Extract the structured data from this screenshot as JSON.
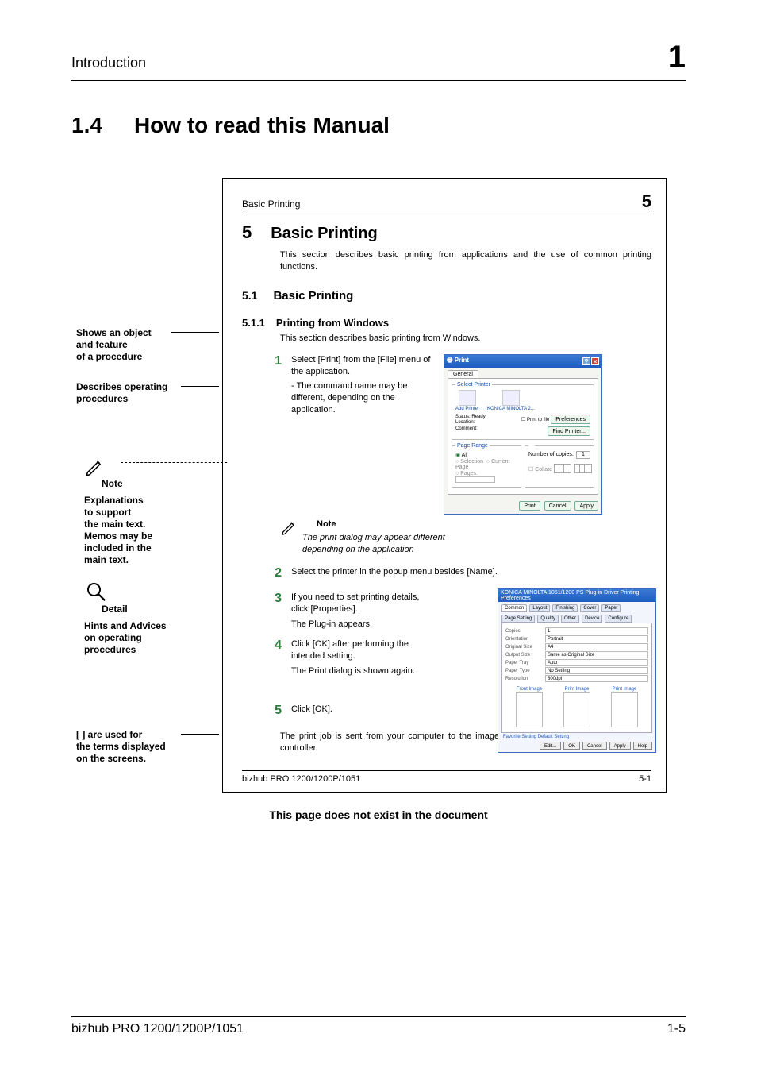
{
  "header": {
    "chapter_label": "Introduction",
    "chapter_number": "1"
  },
  "heading": {
    "number": "1.4",
    "title": "How to read this Manual"
  },
  "annotations": {
    "a1": "Shows an object\nand feature\nof a procedure",
    "a2": "Describes operating\nprocedures",
    "note_label": "Note",
    "a3": "Explanations\nto support\nthe main text.\nMemos may be\nincluded in the\nmain text.",
    "detail_label": "Detail",
    "a4": "Hints and Advices\non operating\nprocedures",
    "a5": "[ ] are used for\nthe terms displayed\non the screens."
  },
  "sample": {
    "running_left": "Basic Printing",
    "running_right": "5",
    "h5_num": "5",
    "h5_title": "Basic Printing",
    "h5_body": "This section describes basic printing from applications and the use of common printing functions.",
    "h51_num": "5.1",
    "h51_title": "Basic Printing",
    "h511_num": "5.1.1",
    "h511_title": "Printing from Windows",
    "h511_body": "This section describes basic printing from Windows.",
    "steps": [
      {
        "n": "1",
        "text": "Select [Print] from the [File] menu of the application.",
        "sub": "- The command name may be different, depending on the application."
      },
      {
        "n": "2",
        "text": "Select the printer in the popup menu besides [Name]."
      },
      {
        "n": "3",
        "text": "If you need to set printing details, click [Properties].",
        "sub": "The Plug-in appears."
      },
      {
        "n": "4",
        "text": "Click [OK] after performing the intended setting.",
        "sub": "The Print dialog is shown again."
      },
      {
        "n": "5",
        "text": "Click [OK]."
      }
    ],
    "note_label": "Note",
    "note_text": "The print dialog may appear different depending on the application",
    "final_text": "The print job is sent from your computer to the image controller and then processed by the controller.",
    "footer_left": "bizhub PRO 1200/1200P/1051",
    "footer_right": "5-1"
  },
  "print_dialog": {
    "title": "Print",
    "tab": "General",
    "select_printer_legend": "Select Printer",
    "printers": [
      "Add Printer",
      "KONICA MINOLTA 2..."
    ],
    "status_label": "Status:",
    "status_value": "Ready",
    "location_label": "Location:",
    "comment_label": "Comment:",
    "print_to_file": "Print to file",
    "preferences_btn": "Preferences",
    "find_printer_btn": "Find Printer...",
    "page_range_legend": "Page Range",
    "range_all": "All",
    "range_selection": "Selection",
    "range_current": "Current Page",
    "range_pages": "Pages:",
    "copies_label": "Number of copies:",
    "copies_value": "1",
    "collate_label": "Collate",
    "btn_print": "Print",
    "btn_cancel": "Cancel",
    "btn_apply": "Apply"
  },
  "plugin_dialog": {
    "title": "KONICA MINOLTA 1051/1200 PS Plug-in Driver Printing Preferences",
    "tabs": [
      "Common",
      "Layout",
      "Finishing",
      "Cover",
      "Paper",
      "Page Setting",
      "Quality",
      "Other",
      "Device",
      "Configure"
    ],
    "fields": {
      "copies": "Copies",
      "orientation": "Orientation",
      "original_size": "Original Size",
      "output_size": "Output Size",
      "paper_tray": "Paper Tray",
      "paper_type": "Paper Type",
      "resolution": "Resolution"
    },
    "values": {
      "copies": "1",
      "orientation": "Portrait",
      "original_size": "A4",
      "output_size": "Same as Original Size",
      "paper_tray": "Auto",
      "paper_type": "No Setting",
      "resolution": "600dpi"
    },
    "preview_labels": [
      "Front Image",
      "Print Image",
      "Print Image"
    ],
    "bottom_left": "Favorite Setting   Default Setting",
    "btns": [
      "Edit...",
      "OK",
      "Cancel",
      "Apply",
      "Help"
    ]
  },
  "caption": "This page does not exist in the document",
  "footer": {
    "left": "bizhub PRO 1200/1200P/1051",
    "right": "1-5"
  }
}
